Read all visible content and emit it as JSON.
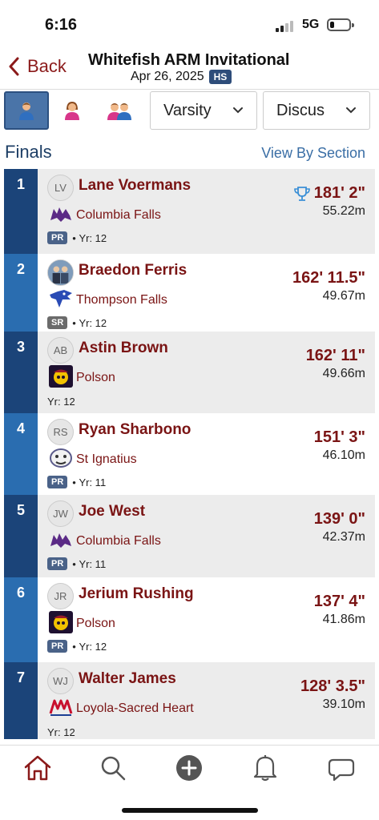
{
  "status_bar": {
    "time": "6:16",
    "network": "5G"
  },
  "header": {
    "back_label": "Back",
    "title": "Whitefish ARM Invitational",
    "date": "Apr 26, 2025",
    "level_badge": "HS"
  },
  "filters": {
    "gender_icons": [
      "male-athlete-icon",
      "female-athlete-icon",
      "coed-athletes-icon"
    ],
    "level_select": "Varsity",
    "event_select": "Discus"
  },
  "section": {
    "title": "Finals",
    "view_by_label": "View By Section"
  },
  "results": [
    {
      "place": "1",
      "initials": "LV",
      "name": "Lane Voermans",
      "school": "Columbia Falls",
      "badge": "PR",
      "year": "Yr: 12",
      "mark": "181' 2\"",
      "metric": "55.22m",
      "trophy": true
    },
    {
      "place": "2",
      "initials": "",
      "name": "Braedon Ferris",
      "school": "Thompson Falls",
      "badge": "SR",
      "year": "Yr: 12",
      "mark": "162' 11.5\"",
      "metric": "49.67m",
      "trophy": false
    },
    {
      "place": "3",
      "initials": "AB",
      "name": "Astin Brown",
      "school": "Polson",
      "badge": "",
      "year": "Yr: 12",
      "mark": "162' 11\"",
      "metric": "49.66m",
      "trophy": false
    },
    {
      "place": "4",
      "initials": "RS",
      "name": "Ryan Sharbono",
      "school": "St Ignatius",
      "badge": "PR",
      "year": "Yr: 11",
      "mark": "151' 3\"",
      "metric": "46.10m",
      "trophy": false
    },
    {
      "place": "5",
      "initials": "JW",
      "name": "Joe West",
      "school": "Columbia Falls",
      "badge": "PR",
      "year": "Yr: 11",
      "mark": "139' 0\"",
      "metric": "42.37m",
      "trophy": false
    },
    {
      "place": "6",
      "initials": "JR",
      "name": "Jerium Rushing",
      "school": "Polson",
      "badge": "PR",
      "year": "Yr: 12",
      "mark": "137' 4\"",
      "metric": "41.86m",
      "trophy": false
    },
    {
      "place": "7",
      "initials": "WJ",
      "name": "Walter James",
      "school": "Loyola-Sacred Heart",
      "badge": "",
      "year": "Yr: 12",
      "mark": "128' 3.5\"",
      "metric": "39.10m",
      "trophy": false
    }
  ],
  "tabs": [
    "home-icon",
    "search-icon",
    "add-icon",
    "notifications-icon",
    "messages-icon"
  ],
  "colors": {
    "accent": "#7a1414",
    "navy": "#1e3f66",
    "place_dark": "#1b4479",
    "place_light": "#2a6db0",
    "row_alt": "#ececec"
  }
}
